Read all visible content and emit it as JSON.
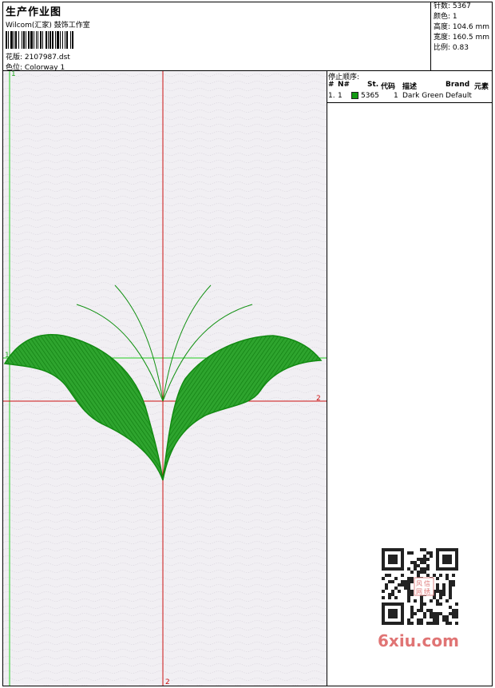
{
  "header": {
    "title": "生产作业图",
    "company": "Wilcom(汇家) 鼓饰工作室",
    "design_label": "花版:",
    "design_value": "2107987.dst",
    "colorway_label": "色位:",
    "colorway_value": "Colorway 1"
  },
  "stats": {
    "stitches": "针数: 5367",
    "colors": "颜色: 1",
    "height": "高度: 104.6 mm",
    "width": "宽度: 160.5 mm",
    "scale": "比例: 0.83"
  },
  "stop_panel": {
    "title": "停止顺序:",
    "columns": {
      "num": "#",
      "no": "N#",
      "st": "St.",
      "code": "代码",
      "desc": "描述",
      "brand": "Brand",
      "element": "元素"
    },
    "rows": [
      {
        "num": "1.",
        "no": "1",
        "color": "#139a13",
        "st": "5365",
        "code": "1",
        "desc": "Dark Green",
        "brand": "Default"
      }
    ]
  },
  "canvas": {
    "marker_top_green": "1",
    "marker_left_green": "1",
    "marker_right_red": "2",
    "marker_bottom_red": "2",
    "thread_color": "#129112",
    "guide_green": "#22cc22",
    "guide_red": "#cc1111"
  },
  "watermark": {
    "qr_text_1": "风",
    "qr_text_2": "信",
    "qr_text_3": "网",
    "qr_text_4": "绣",
    "site": "6xiu.com"
  }
}
